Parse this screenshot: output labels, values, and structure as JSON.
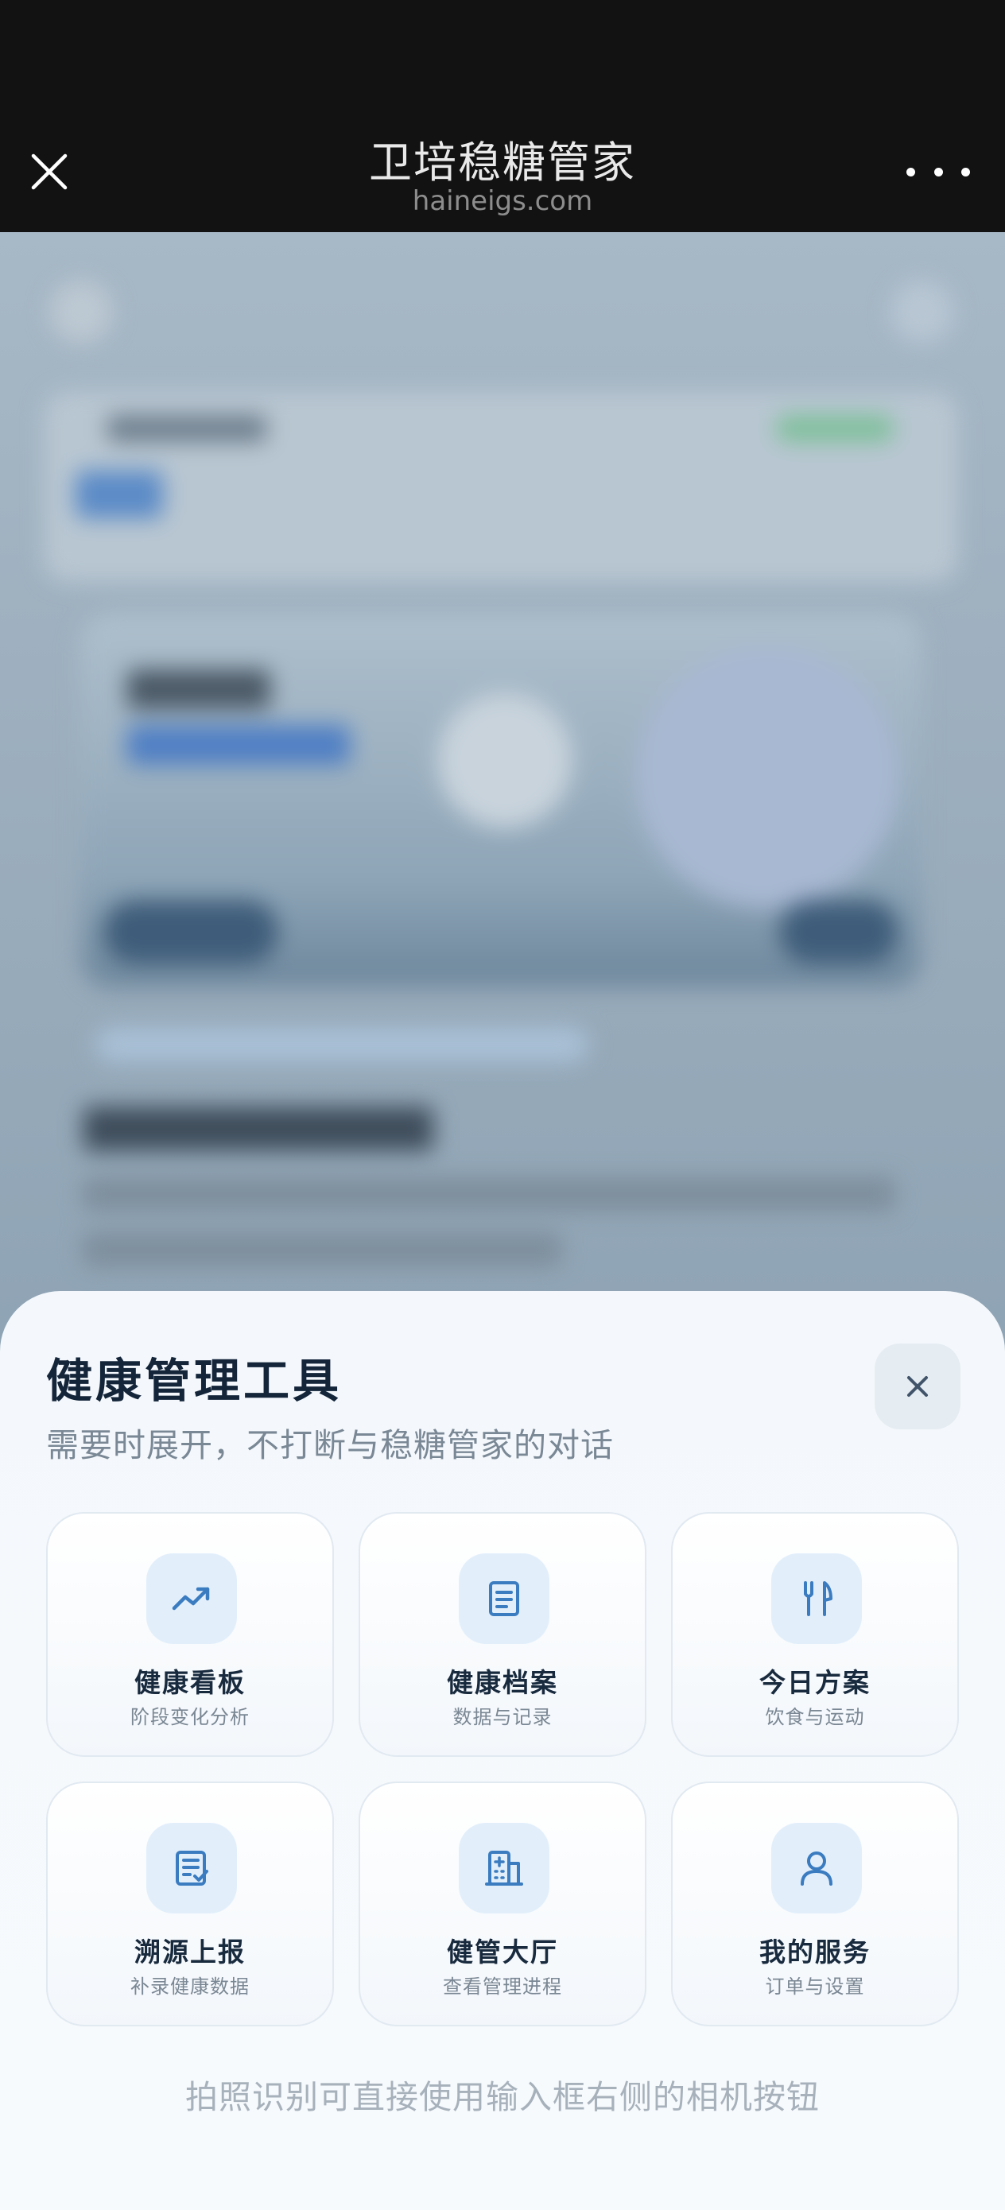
{
  "header": {
    "title": "卫培稳糖管家",
    "subtitle": "haineigs.com"
  },
  "sheet": {
    "title": "健康管理工具",
    "description": "需要时展开，不打断与稳糖管家的对话",
    "tools": [
      {
        "icon": "trend-chart-icon",
        "title": "健康看板",
        "subtitle": "阶段变化分析"
      },
      {
        "icon": "document-list-icon",
        "title": "健康档案",
        "subtitle": "数据与记录"
      },
      {
        "icon": "fork-knife-icon",
        "title": "今日方案",
        "subtitle": "饮食与运动"
      },
      {
        "icon": "report-check-icon",
        "title": "溯源上报",
        "subtitle": "补录健康数据"
      },
      {
        "icon": "building-icon",
        "title": "健管大厅",
        "subtitle": "查看管理进程"
      },
      {
        "icon": "user-icon",
        "title": "我的服务",
        "subtitle": "订单与设置"
      }
    ],
    "footer_hint": "拍照识别可直接使用输入框右侧的相机按钮"
  },
  "colors": {
    "accent": "#3b7cc0",
    "icon_bg": "#e2effb",
    "title_text": "#14253a"
  }
}
